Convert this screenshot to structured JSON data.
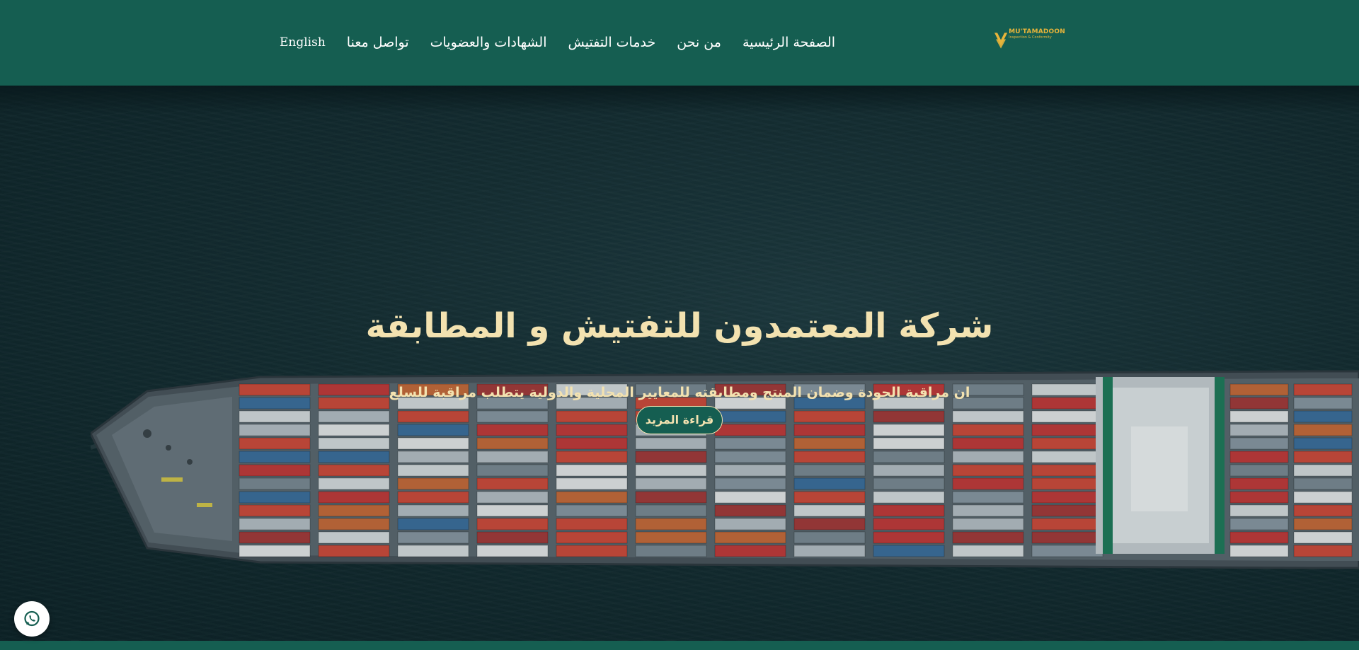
{
  "brand": {
    "logo_name": "MU'TAMADOON",
    "logo_tagline": "Inspection & Conformity",
    "primary_color": "#155e51",
    "accent_color": "#e7b43a",
    "hero_text_color": "#f3e2b0"
  },
  "nav": {
    "items": [
      {
        "label": "English"
      },
      {
        "label": "تواصل معنا"
      },
      {
        "label": "الشهادات والعضويات"
      },
      {
        "label": "خدمات التفتيش"
      },
      {
        "label": "من نحن"
      },
      {
        "label": "الصفحة الرئيسية"
      }
    ]
  },
  "hero": {
    "title": "شركة المعتمدون للتفتيش و المطابقة",
    "subtitle": "ان مراقبة الجودة وضمان المنتج ومطابقته للمعايير المحلية والدولية يتطلب مراقبة للسلع",
    "button_label": "قراءة المزيد",
    "background_icon": "container-ship-aerial-image"
  },
  "floating": {
    "whatsapp_icon": "whatsapp-icon"
  }
}
